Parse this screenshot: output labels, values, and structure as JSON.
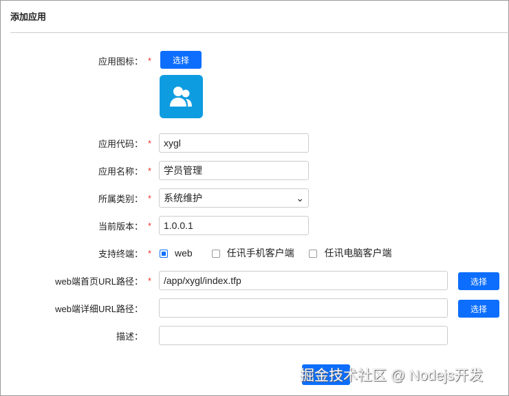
{
  "title": "添加应用",
  "fields": {
    "icon": {
      "label": "应用图标：",
      "button": "选择"
    },
    "code": {
      "label": "应用代码：",
      "value": "xygl"
    },
    "name": {
      "label": "应用名称：",
      "value": "学员管理"
    },
    "category": {
      "label": "所属类别：",
      "value": "系统维护"
    },
    "version": {
      "label": "当前版本：",
      "value": "1.0.0.1"
    },
    "terminals": {
      "label": "支持终端：",
      "options": [
        {
          "label": "web",
          "checked": true
        },
        {
          "label": "任讯手机客户端",
          "checked": false
        },
        {
          "label": "任讯电脑客户端",
          "checked": false
        }
      ]
    },
    "web_home": {
      "label": "web端首页URL路径：",
      "value": "/app/xygl/index.tfp",
      "button": "选择"
    },
    "web_detail": {
      "label": "web端详细URL路径：",
      "value": "",
      "button": "选择"
    },
    "desc": {
      "label": "描述：",
      "value": ""
    }
  },
  "required": "*",
  "watermark": "掘金技术社区 @ Nodejs开发"
}
